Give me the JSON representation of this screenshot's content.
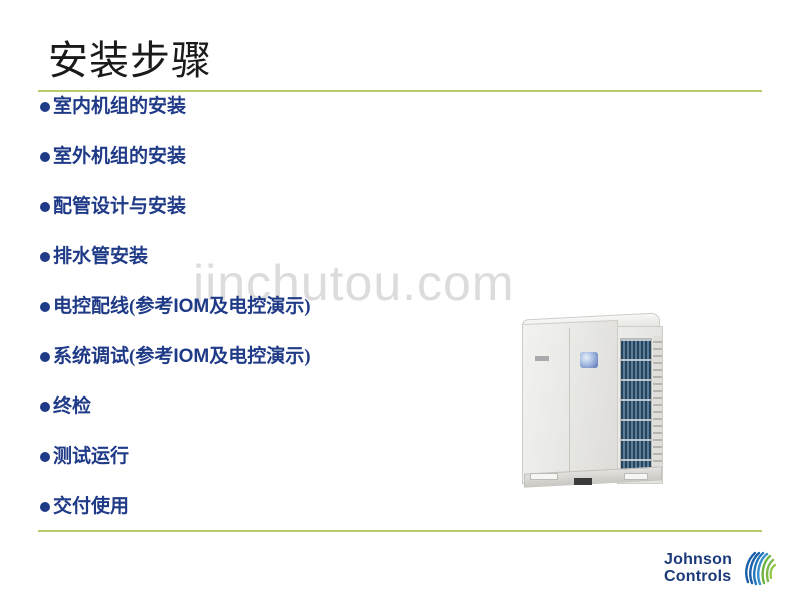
{
  "slide": {
    "title": "安装步骤",
    "watermark": "jinchutou.com",
    "accent_green": "#b5cc6a",
    "bullet_blue": "#1f3a87",
    "title_color": "#1a1a1a",
    "watermark_color": "#dcdcdc",
    "background": "#ffffff"
  },
  "bullets": [
    {
      "text": "室内机组的安装"
    },
    {
      "text": "室外机组的安装"
    },
    {
      "text": "配管设计与安装"
    },
    {
      "text": "排水管安装"
    },
    {
      "text": "电控配线(参考IOM及电控演示)"
    },
    {
      "text": "系统调试(参考IOM及电控演示)"
    },
    {
      "text": "终检"
    },
    {
      "text": "测试运行"
    },
    {
      "text": "交付使用"
    }
  ],
  "photo": {
    "caption": "vrf-outdoor-condensing-unit"
  },
  "logo": {
    "line1": "Johnson",
    "line2": "Controls",
    "text_color": "#1b3a7a",
    "mark_blue": "#1b5fa8",
    "mark_green": "#7ab648"
  }
}
